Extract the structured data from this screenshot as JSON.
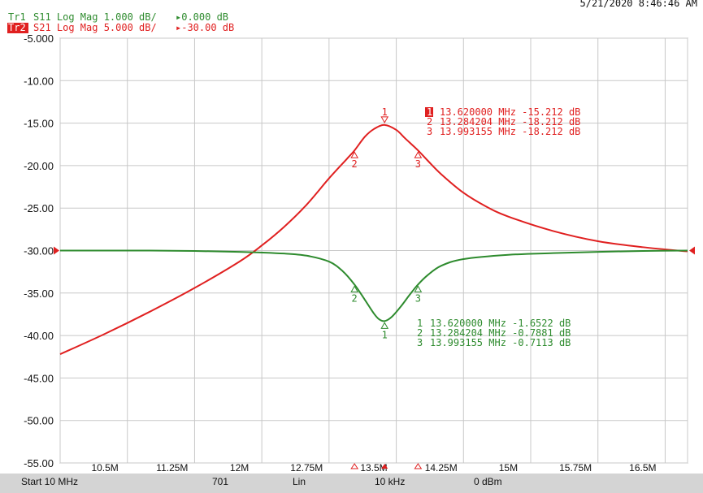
{
  "timestamp": "5/21/2020 8:46:46 AM",
  "traces": [
    {
      "id": "Tr1",
      "label": "S11 Log Mag 1.000 dB/",
      "ref": "▸0.000 dB",
      "color": "#2e8b2e"
    },
    {
      "id": "Tr2",
      "label": "S21 Log Mag 5.000 dB/",
      "ref": "▸-30.00 dB",
      "color": "#e02020"
    }
  ],
  "footer": {
    "start": "Start 10 MHz",
    "points": "701",
    "sweep": "Lin",
    "ifbw": "10 kHz",
    "power": "0 dBm"
  },
  "chart_data": {
    "type": "line",
    "xlim": [
      10.0,
      17.0
    ],
    "ylim": [
      -55.0,
      -5.0
    ],
    "y_ticks": [
      -5,
      -10,
      -15,
      -20,
      -25,
      -30,
      -35,
      -40,
      -45,
      -50,
      -55
    ],
    "y_tick_labels": [
      "-5.000",
      "-10.00",
      "-15.00",
      "-20.00",
      "-25.00",
      "-30.00",
      "-35.00",
      "-40.00",
      "-45.00",
      "-50.00",
      "-55.00"
    ],
    "x_ticks": [
      10.5,
      11.25,
      12.0,
      12.75,
      13.5,
      14.25,
      15.0,
      15.75,
      16.5
    ],
    "x_tick_labels": [
      "10.5M",
      "11.25M",
      "12M",
      "12.75M",
      "13.5M",
      "14.25M",
      "15M",
      "15.75M",
      "16.5M"
    ],
    "x_grid": [
      10.0,
      10.75,
      11.5,
      12.25,
      13.0,
      13.75,
      14.5,
      15.25,
      16.0,
      16.75,
      17.0
    ],
    "grid": true,
    "reference_level": -30.0,
    "series": [
      {
        "name": "S21",
        "color": "#e02020",
        "x": [
          10.0,
          10.5,
          11.0,
          11.5,
          12.0,
          12.25,
          12.5,
          12.75,
          13.0,
          13.2,
          13.284,
          13.4,
          13.5,
          13.62,
          13.75,
          13.85,
          13.993,
          14.1,
          14.25,
          14.5,
          14.75,
          15.0,
          15.5,
          16.0,
          16.5,
          17.0
        ],
        "y": [
          -42.2,
          -39.8,
          -37.2,
          -34.4,
          -31.3,
          -29.4,
          -27.2,
          -24.6,
          -21.5,
          -19.2,
          -18.212,
          -16.6,
          -15.7,
          -15.212,
          -15.8,
          -16.8,
          -18.212,
          -19.4,
          -21.0,
          -23.2,
          -24.8,
          -26.0,
          -27.7,
          -28.9,
          -29.6,
          -30.1
        ]
      },
      {
        "name": "S11",
        "color": "#2e8b2e",
        "x": [
          10.0,
          10.5,
          11.0,
          11.5,
          12.0,
          12.5,
          12.75,
          13.0,
          13.15,
          13.284,
          13.4,
          13.5,
          13.56,
          13.62,
          13.7,
          13.8,
          13.9,
          13.993,
          14.1,
          14.25,
          14.5,
          15.0,
          15.5,
          16.0,
          16.5,
          17.0
        ],
        "y": [
          -30.0,
          -30.0,
          -30.0,
          -30.05,
          -30.15,
          -30.35,
          -30.6,
          -31.3,
          -32.4,
          -34.0,
          -35.8,
          -37.4,
          -38.1,
          -38.3,
          -37.8,
          -36.6,
          -35.2,
          -34.0,
          -32.9,
          -31.8,
          -31.0,
          -30.5,
          -30.3,
          -30.15,
          -30.05,
          -30.0
        ]
      }
    ],
    "markers": [
      {
        "trace": "S21",
        "n": "1",
        "x": 13.62,
        "y": -15.212,
        "readout": "13.620000 MHz -15.212 dB",
        "active": true
      },
      {
        "trace": "S21",
        "n": "2",
        "x": 13.284,
        "y": -18.212,
        "readout": "13.284204 MHz -18.212 dB",
        "active": false
      },
      {
        "trace": "S21",
        "n": "3",
        "x": 13.993,
        "y": -18.212,
        "readout": "13.993155 MHz -18.212 dB",
        "active": false
      },
      {
        "trace": "S11",
        "n": "1",
        "x": 13.62,
        "y": -38.3,
        "readout": "13.620000 MHz -1.6522 dB",
        "active": false
      },
      {
        "trace": "S11",
        "n": "2",
        "x": 13.284,
        "y": -34.0,
        "readout": "13.284204 MHz -0.7881 dB",
        "active": false
      },
      {
        "trace": "S11",
        "n": "3",
        "x": 13.993,
        "y": -34.0,
        "readout": "13.993155 MHz -0.7113 dB",
        "active": false
      }
    ]
  }
}
